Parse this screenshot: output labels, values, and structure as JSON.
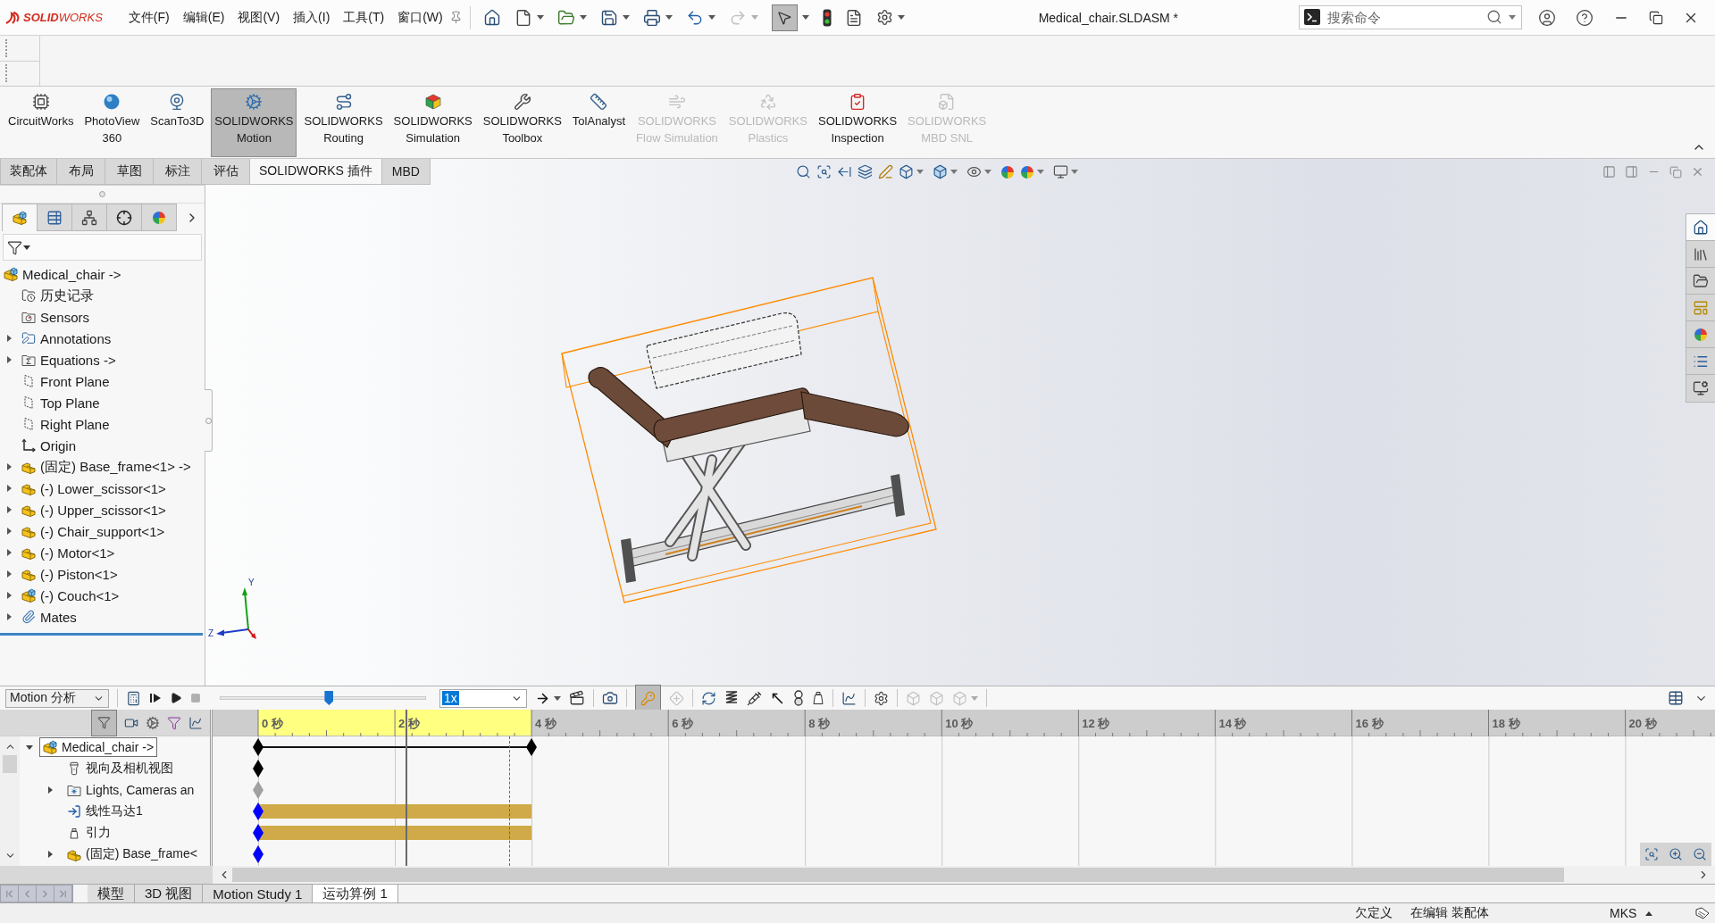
{
  "title_bar": {
    "logo": "**SOLID**WORKS",
    "menus": [
      "文件(F)",
      "编辑(E)",
      "视图(V)",
      "插入(I)",
      "工具(T)",
      "窗口(W)"
    ],
    "quick_toolbar": {
      "redo_disabled": true,
      "select_pressed": true
    },
    "document_title": "Medical_chair.SLDASM *",
    "search": {
      "placeholder": "搜索命令"
    }
  },
  "command_manager": {
    "buttons": [
      {
        "lines": [
          "CircuitWorks"
        ],
        "selected": false,
        "disabled": false
      },
      {
        "lines": [
          "PhotoView",
          "360"
        ],
        "selected": false,
        "disabled": false
      },
      {
        "lines": [
          "ScanTo3D"
        ],
        "selected": false,
        "disabled": false
      },
      {
        "lines": [
          "SOLIDWORKS",
          "Motion"
        ],
        "selected": true,
        "disabled": false
      },
      {
        "lines": [
          "SOLIDWORKS",
          "Routing"
        ],
        "selected": false,
        "disabled": false
      },
      {
        "lines": [
          "SOLIDWORKS",
          "Simulation"
        ],
        "selected": false,
        "disabled": false
      },
      {
        "lines": [
          "SOLIDWORKS",
          "Toolbox"
        ],
        "selected": false,
        "disabled": false
      },
      {
        "lines": [
          "TolAnalyst"
        ],
        "selected": false,
        "disabled": false
      },
      {
        "lines": [
          "SOLIDWORKS",
          "Flow Simulation"
        ],
        "selected": false,
        "disabled": true
      },
      {
        "lines": [
          "SOLIDWORKS",
          "Plastics"
        ],
        "selected": false,
        "disabled": true
      },
      {
        "lines": [
          "SOLIDWORKS",
          "Inspection"
        ],
        "selected": false,
        "disabled": false
      },
      {
        "lines": [
          "SOLIDWORKS",
          "MBD SNL"
        ],
        "selected": false,
        "disabled": true
      }
    ]
  },
  "ribbon_tabs": [
    {
      "label": "装配体",
      "selected": false
    },
    {
      "label": "布局",
      "selected": false
    },
    {
      "label": "草图",
      "selected": false
    },
    {
      "label": "标注",
      "selected": false
    },
    {
      "label": "评估",
      "selected": false
    },
    {
      "label": "SOLIDWORKS 插件",
      "selected": true
    },
    {
      "label": "MBD",
      "selected": false
    }
  ],
  "feature_manager": {
    "tabs": [
      {
        "selected": true
      },
      {
        "selected": false
      },
      {
        "selected": false
      },
      {
        "selected": false
      },
      {
        "selected": false
      }
    ],
    "tree": {
      "label": "Medical_chair ->",
      "kind": "assembly",
      "selected": false,
      "children": [
        {
          "label": "历史记录",
          "kind": "history",
          "expandable": false,
          "selected": false
        },
        {
          "label": "Sensors",
          "kind": "sensors",
          "expandable": false,
          "selected": false
        },
        {
          "label": "Annotations",
          "kind": "annotations",
          "expandable": true,
          "selected": false
        },
        {
          "label": "Equations ->",
          "kind": "equations",
          "expandable": true,
          "selected": false
        },
        {
          "label": "Front Plane",
          "kind": "plane",
          "expandable": false,
          "selected": false
        },
        {
          "label": "Top Plane",
          "kind": "plane",
          "expandable": false,
          "selected": false
        },
        {
          "label": "Right Plane",
          "kind": "plane",
          "expandable": false,
          "selected": false
        },
        {
          "label": "Origin",
          "kind": "origin",
          "expandable": false,
          "selected": false
        },
        {
          "label": "(固定) Base_frame<1> ->",
          "kind": "part",
          "expandable": true,
          "selected": false
        },
        {
          "label": "(-) Lower_scissor<1>",
          "kind": "part",
          "expandable": true,
          "selected": false
        },
        {
          "label": "(-) Upper_scissor<1>",
          "kind": "part",
          "expandable": true,
          "selected": false
        },
        {
          "label": "(-) Chair_support<1>",
          "kind": "part",
          "expandable": true,
          "selected": false
        },
        {
          "label": "(-) Motor<1>",
          "kind": "part",
          "expandable": true,
          "selected": false
        },
        {
          "label": "(-) Piston<1>",
          "kind": "part",
          "expandable": true,
          "selected": false
        },
        {
          "label": "(-) Couch<1>",
          "kind": "assembly",
          "expandable": true,
          "selected": false
        },
        {
          "label": "Mates",
          "kind": "mates",
          "expandable": true,
          "selected": false
        }
      ]
    }
  },
  "viewport": {
    "triad_labels": [
      "Y",
      "Z"
    ]
  },
  "task_pane": {
    "tabs": [
      {
        "selected": true
      },
      {
        "selected": false
      },
      {
        "selected": false
      },
      {
        "selected": false
      },
      {
        "selected": false
      },
      {
        "selected": false
      },
      {
        "selected": false
      }
    ]
  },
  "motion_manager": {
    "study_type": "Motion 分析",
    "time_slider": {
      "level": 0.53
    },
    "playback_speed": "1x",
    "autokey_pressed": true,
    "filter_pressed": true,
    "timeline": {
      "ticks": [
        {
          "label": "0 秒",
          "highlighted": true
        },
        {
          "label": "2 秒",
          "highlighted": true
        },
        {
          "label": "4 秒",
          "highlighted": false
        },
        {
          "label": "6 秒",
          "highlighted": false
        },
        {
          "label": "8 秒",
          "highlighted": false
        },
        {
          "label": "10 秒",
          "highlighted": false
        },
        {
          "label": "12 秒",
          "highlighted": false
        },
        {
          "label": "14 秒",
          "highlighted": false
        },
        {
          "label": "16 秒",
          "highlighted": false
        },
        {
          "label": "18 秒",
          "highlighted": false
        },
        {
          "label": "20 秒",
          "highlighted": false
        }
      ]
    },
    "tree": {
      "label": "Medical_chair ->",
      "kind": "assembly",
      "expanded": true,
      "selected": true,
      "track": {
        "kind": "span",
        "color": "#000000"
      },
      "children": [
        {
          "label": "视向及相机视图",
          "kind": "camera",
          "expandable": false,
          "selected": false,
          "track": {
            "kind": "point",
            "color": "#000000"
          }
        },
        {
          "label": "Lights, Cameras an",
          "kind": "lights",
          "expandable": true,
          "selected": false,
          "track": {
            "kind": "point",
            "color": "#a0a0a0"
          }
        },
        {
          "label": "线性马达1",
          "kind": "motor",
          "expandable": false,
          "selected": false,
          "track": {
            "kind": "bar",
            "color": "#0000ff"
          }
        },
        {
          "label": "引力",
          "kind": "gravity",
          "expandable": false,
          "selected": false,
          "track": {
            "kind": "bar",
            "color": "#0000ff"
          }
        },
        {
          "label": "(固定) Base_frame<",
          "kind": "part",
          "expandable": true,
          "selected": false,
          "track": {
            "kind": "point",
            "color": "#0000ff"
          }
        }
      ]
    }
  },
  "study_tabs": [
    {
      "label": "模型",
      "selected": false
    },
    {
      "label": "3D 视图",
      "selected": false
    },
    {
      "label": "Motion Study 1",
      "selected": false
    },
    {
      "label": "运动算例 1",
      "selected": true
    }
  ],
  "status_bar": {
    "definition": "欠定义",
    "mode": "在编辑 装配体",
    "units": "MKS"
  }
}
